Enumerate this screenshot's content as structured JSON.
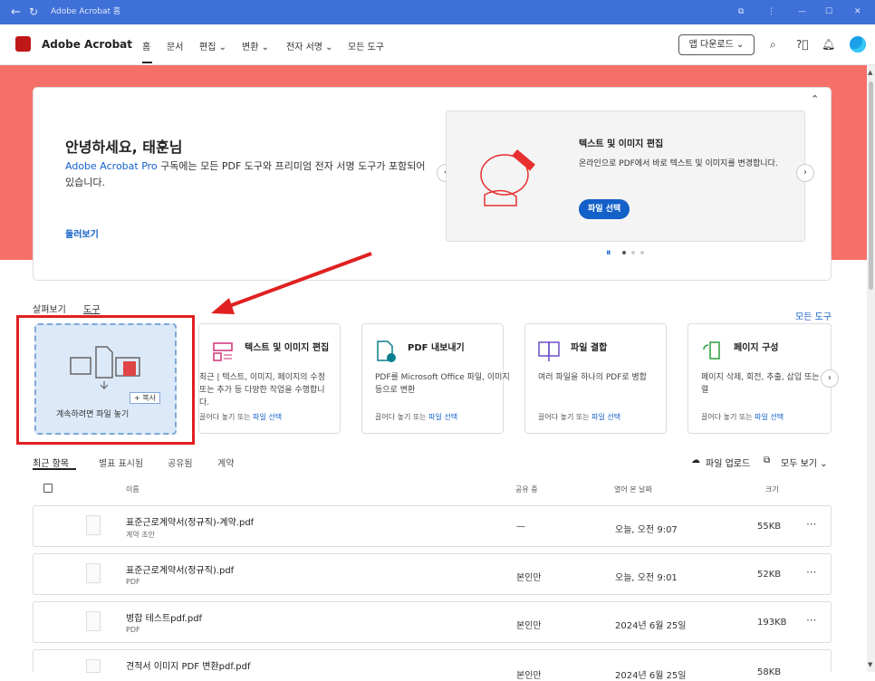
{
  "window": {
    "title": "Adobe Acrobat 홈"
  },
  "app": {
    "brand": "Adobe Acrobat",
    "nav": [
      "홈",
      "문서",
      "편집 ⌄",
      "변환 ⌄",
      "전자 서명 ⌄",
      "모든 도구"
    ],
    "download_label": "앱 다운로드 ⌄"
  },
  "hero": {
    "greeting": "안녕하세요, 태훈님",
    "desc_prefix": "Adobe Acrobat Pro",
    "desc_rest": " 구독에는 모든 PDF 도구와 프리미엄 전자 서명 도구가 포함되어 있습니다.",
    "tour_link": "둘러보기",
    "card": {
      "title": "텍스트 및 이미지 편집",
      "desc": "온라인으로 PDF에서 바로 텍스트 및 이미지를 변경합니다.",
      "button": "파일 선택"
    }
  },
  "tools_section": {
    "tabs": [
      "살펴보기",
      "도구"
    ],
    "all_tools": "모든 도구",
    "dropzone": {
      "label": "계속하려면 파일 놓기",
      "drag_label": "+ 복사"
    },
    "cards": [
      {
        "title": "텍스트 및 이미지 편집",
        "desc": "최근 | 텍스트, 이미지, 페이지의 수정 또는 추가 등 다양한 작업을 수행합니다.",
        "hint": "끌어다 놓기 또는 ",
        "link": "파일 선택"
      },
      {
        "title": "PDF 내보내기",
        "desc": "PDF를 Microsoft Office 파일, 이미지 등으로 변환",
        "hint": "끌어다 놓기 또는 ",
        "link": "파일 선택"
      },
      {
        "title": "파일 결합",
        "desc": "여러 파일을 하나의 PDF로 병합",
        "hint": "끌어다 놓기 또는 ",
        "link": "파일 선택"
      },
      {
        "title": "페이지 구성",
        "desc": "페이지 삭제, 회전, 추출, 삽입 또는 재정렬",
        "hint": "끌어다 놓기 또는 ",
        "link": "파일 선택"
      }
    ]
  },
  "recent": {
    "tabs": [
      "최근 항목",
      "별표 표시됨",
      "공유됨",
      "계약"
    ],
    "upload": "파일 업로드",
    "view_all": "모두 보기 ⌄",
    "headers": {
      "name": "이름",
      "shared": "공유 중",
      "opened": "열어 본 날짜",
      "size": "크기"
    },
    "rows": [
      {
        "name": "표준근로계약서(정규직)-계약.pdf",
        "type": "계약 초안",
        "shared": "—",
        "opened": "오늘, 오전 9:07",
        "size": "55KB"
      },
      {
        "name": "표준근로계약서(정규직).pdf",
        "type": "PDF",
        "shared": "본인만",
        "opened": "오늘, 오전 9:01",
        "size": "52KB"
      },
      {
        "name": "병합 테스트pdf.pdf",
        "type": "PDF",
        "shared": "본인만",
        "opened": "2024년 6월 25일",
        "size": "193KB"
      },
      {
        "name": "견적서 이미지 PDF 변환pdf.pdf",
        "type": "",
        "shared": "본인만",
        "opened": "2024년 6월 25일",
        "size": "58KB"
      }
    ]
  },
  "colors": {
    "accent": "#1460c9",
    "hero_bg": "#f6706a",
    "highlight": "#e02020",
    "titlebar": "#3f70d8"
  }
}
